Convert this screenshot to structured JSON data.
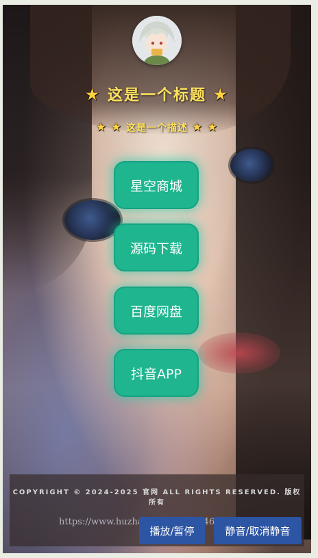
{
  "header": {
    "avatar_icon": "anime-avatar-icon",
    "title_star": "★",
    "title": "这是一个标题",
    "subtitle_star": "★",
    "subtitle": "这是一个描述"
  },
  "links": [
    {
      "label": "星空商城"
    },
    {
      "label": "源码下载"
    },
    {
      "label": "百度网盘"
    },
    {
      "label": "抖音APP"
    }
  ],
  "footer": {
    "copyright": "COPYRIGHT © 2024-2025 官网 ALL RIGHTS RESERVED. 版权所有",
    "watermark": "https://www.huzhan.com/ishop34665",
    "play_label": "播放/暂停",
    "mute_label": "静音/取消静音"
  },
  "colors": {
    "button": "#1fb58f",
    "title": "#ffe25e",
    "control": "#2c55a3"
  }
}
